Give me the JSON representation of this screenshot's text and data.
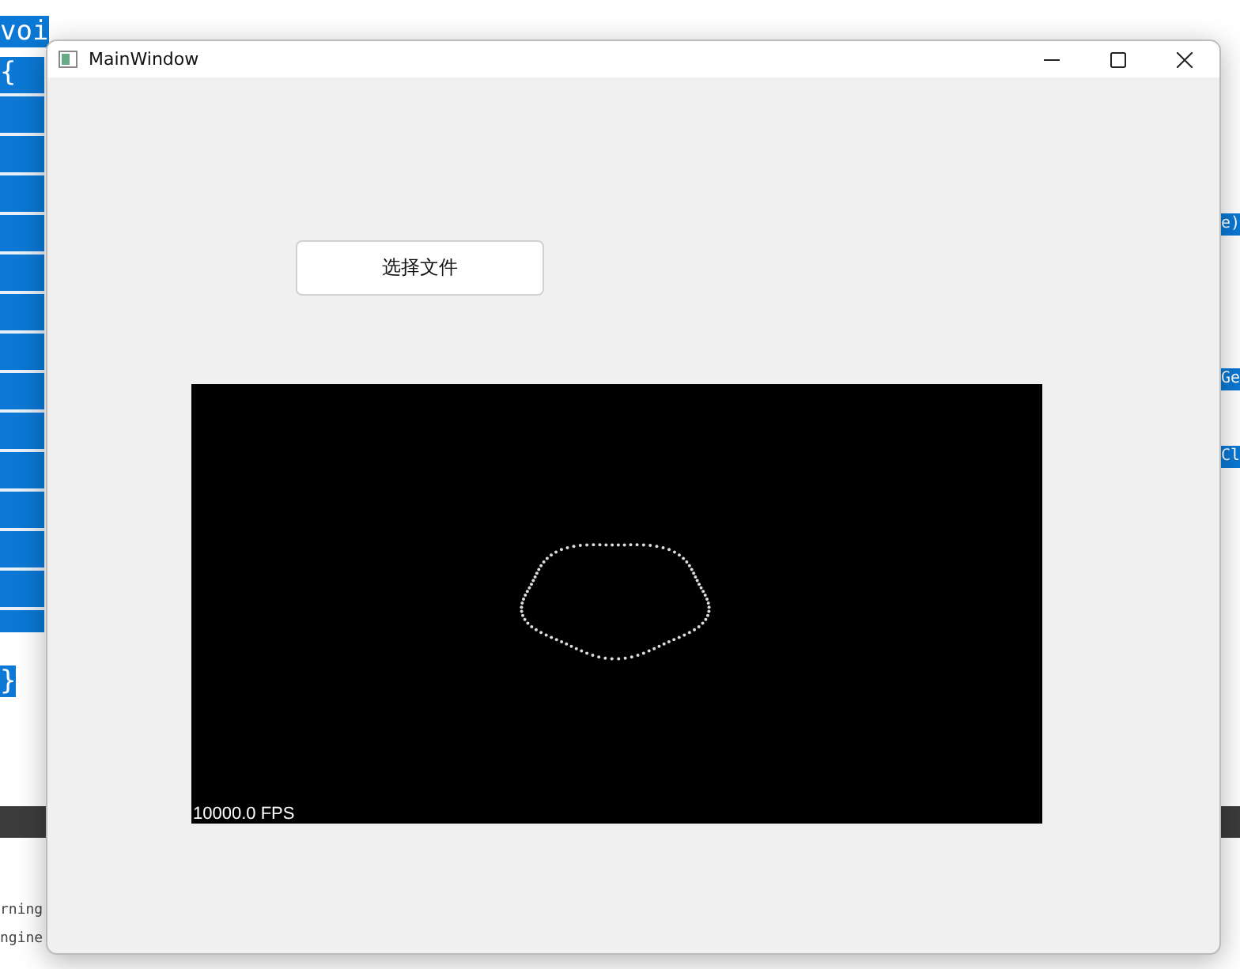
{
  "editor": {
    "fragments": [
      {
        "text": "voi",
        "kind": "selected"
      },
      {
        "text": "{",
        "kind": "selected"
      },
      {
        "text": "}",
        "kind": "selected"
      },
      {
        "text": "e)",
        "kind": "selected"
      },
      {
        "text": "Ge",
        "kind": "selected"
      },
      {
        "text": "Cl",
        "kind": "selected"
      },
      {
        "text": "rning",
        "kind": "plain"
      },
      {
        "text": "ngine",
        "kind": "plain"
      }
    ]
  },
  "window": {
    "title": "MainWindow"
  },
  "button": {
    "label": "选择文件"
  },
  "video": {
    "kind": "picture",
    "overlay": "10000.0 FPS"
  }
}
